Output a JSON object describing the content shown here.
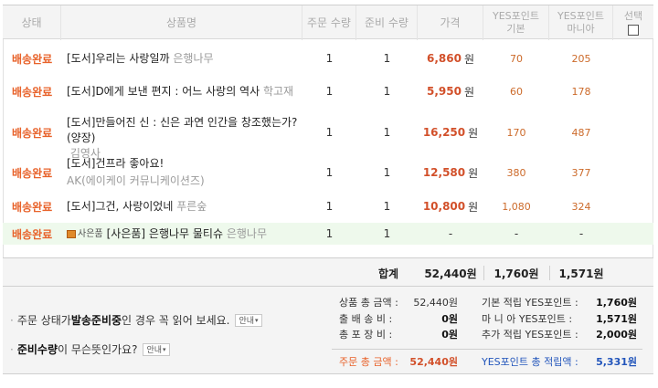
{
  "header": {
    "status": "상태",
    "product": "상품명",
    "order_qty": "주문 수량",
    "prep_qty": "준비 수량",
    "price": "가격",
    "yes_basic_1": "YES포인트",
    "yes_basic_2": "기본",
    "yes_mania_1": "YES포인트",
    "yes_mania_2": "마니아",
    "select": "선택"
  },
  "rows": [
    {
      "status": "배송완료",
      "title": "[도서]우리는 사랑일까",
      "publisher": "은행나무",
      "order_qty": "1",
      "prep_qty": "1",
      "price": "6,860",
      "won": "원",
      "basic": "70",
      "mania": "205"
    },
    {
      "status": "배송완료",
      "title": "[도서]D에게 보낸 편지 : 어느 사랑의 역사",
      "publisher": "학고재",
      "order_qty": "1",
      "prep_qty": "1",
      "price": "5,950",
      "won": "원",
      "basic": "60",
      "mania": "178"
    },
    {
      "status": "배송완료",
      "title": "[도서]만들어진 신 : 신은 과연 인간을 창조했는가? (양장)",
      "publisher": "김영사",
      "order_qty": "1",
      "prep_qty": "1",
      "price": "16,250",
      "won": "원",
      "basic": "170",
      "mania": "487"
    },
    {
      "status": "배송완료",
      "title": "[도서]건프라 좋아요!",
      "publisher": "AK(에이케이 커뮤니케이션즈)",
      "order_qty": "1",
      "prep_qty": "1",
      "price": "12,580",
      "won": "원",
      "basic": "380",
      "mania": "377"
    },
    {
      "status": "배송완료",
      "title": "[도서]그건, 사랑이었네",
      "publisher": "푸른숲",
      "order_qty": "1",
      "prep_qty": "1",
      "price": "10,800",
      "won": "원",
      "basic": "1,080",
      "mania": "324"
    }
  ],
  "gift_row": {
    "status": "배송완료",
    "badge": "사은품",
    "title": "[사은품] 은행나무 물티슈",
    "publisher": "은행나무",
    "order_qty": "1",
    "prep_qty": "1",
    "price": "-",
    "basic": "-",
    "mania": "-"
  },
  "total": {
    "label": "합계",
    "price": "52,440원",
    "basic": "1,760원",
    "mania": "1,571원"
  },
  "notes": {
    "note1_pre": "주문 상태가 ",
    "note1_bold": "발송준비중",
    "note1_post": "인 경우 꼭 읽어 보세요.",
    "note2_bold": "준비수량",
    "note2_post": "이 무슨뜻인가요?",
    "guide": "안내",
    "bullet": "·"
  },
  "summary": {
    "product_total_label": "상품 총 금액 :",
    "product_total_value": "52,440원",
    "shipping_label": "출 배 송 비 :",
    "shipping_value": "0원",
    "packing_label": "총 포 장 비 :",
    "packing_value": "0원",
    "basic_label": "기본 적립 YES포인트 :",
    "basic_value": "1,760원",
    "mania_label": "마 니 아 YES포인트 :",
    "mania_value": "1,571원",
    "extra_label": "추가 적립 YES포인트 :",
    "extra_value": "2,000원",
    "order_total_label": "주문 총 금액 :",
    "order_total_value": "52,440원",
    "points_total_label": "YES포인트 총 적립액 :",
    "points_total_value": "5,331원"
  },
  "colors": {
    "status": "#e8622a",
    "price": "#d2502a",
    "points": "#cc6a2a",
    "points_total": "#2255bb",
    "gift_bg": "#eef9ec"
  }
}
